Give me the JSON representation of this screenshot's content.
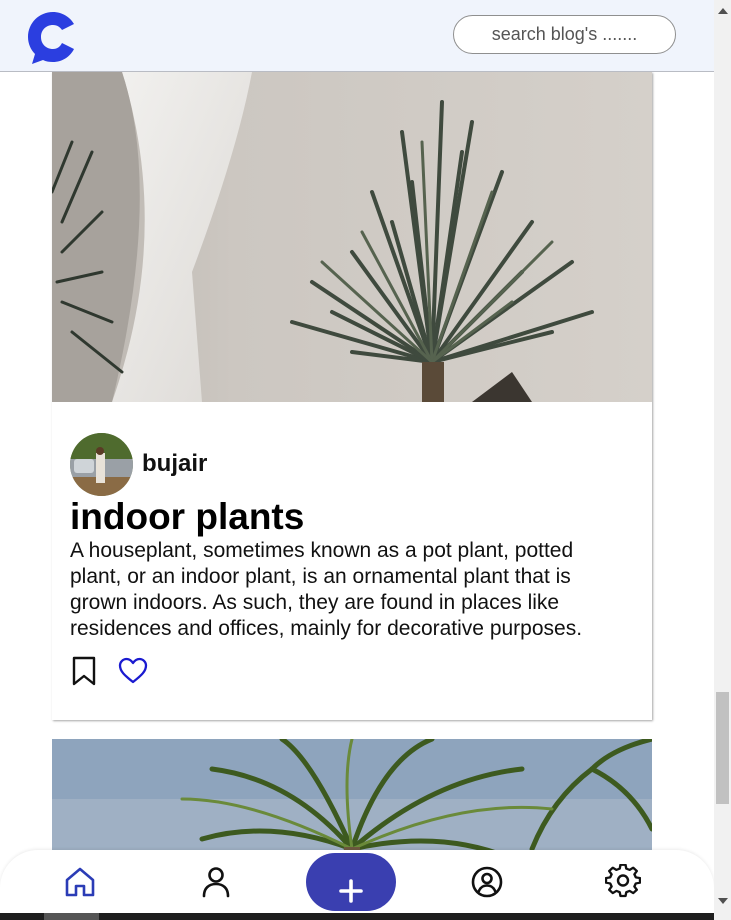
{
  "header": {
    "logo_icon": "chat-c-logo-icon",
    "search_placeholder": "search blog's ......."
  },
  "posts": [
    {
      "image": "indoor-plant-photo",
      "author": "bujair",
      "title": "indoor plants",
      "description": "A houseplant, sometimes known as a pot plant, potted plant, or an indoor plant, is an ornamental plant that is grown indoors. As such, they are found in places like residences and offices, mainly for decorative purposes.",
      "actions": [
        "bookmark-icon",
        "heart-icon"
      ]
    },
    {
      "image": "palm-tree-photo"
    }
  ],
  "bottom_nav": {
    "items": [
      "home-icon",
      "user-icon",
      "plus-icon",
      "account-circle-icon",
      "gear-icon"
    ]
  },
  "colors": {
    "brand": "#2b3ee0",
    "accent_button": "#3a3fb0",
    "header_bg": "#f0f4fc",
    "heart": "#1a1ad0",
    "nav_icon_active": "#2b3cb6"
  }
}
